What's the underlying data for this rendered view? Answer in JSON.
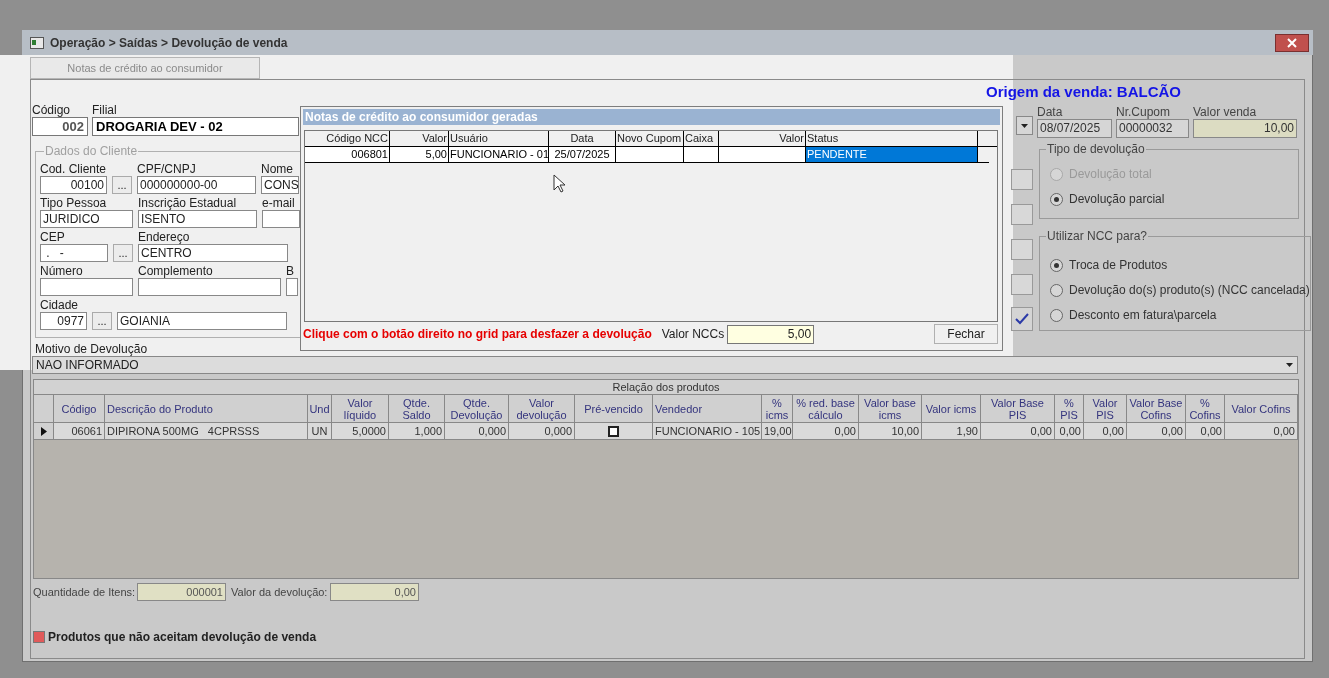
{
  "window": {
    "title": "Operação > Saídas > Devolução de venda"
  },
  "top_button": "Notas de crédito ao consumidor",
  "origin": "Origem da venda: BALCÃO",
  "header": [
    {
      "label": "Código",
      "value": "002"
    },
    {
      "label": "Filial",
      "value": "DROGARIA DEV - 02"
    }
  ],
  "cliente": {
    "title": "Dados do Cliente",
    "rows": [
      [
        {
          "label": "Cod. Cliente",
          "value": "00100",
          "lookup": "..."
        },
        {
          "label": "CPF/CNPJ",
          "value": "000000000-00"
        },
        {
          "label": "Nome",
          "value": "CONS"
        }
      ],
      [
        {
          "label": "Tipo Pessoa",
          "value": "JURIDICO"
        },
        {
          "label": "Inscrição Estadual",
          "value": "ISENTO"
        },
        {
          "label": "e-mail"
        }
      ],
      [
        {
          "label": "CEP",
          "value": " .   -",
          "lookup": "..."
        },
        {
          "label": "Endereço",
          "value": "CENTRO"
        }
      ],
      [
        {
          "label": "Número"
        },
        {
          "label": "Complemento"
        },
        {
          "label": "B"
        }
      ],
      [
        {
          "label": "Cidade",
          "value": "0977",
          "lookup": "..."
        },
        {
          "value": "GOIANIA"
        }
      ]
    ]
  },
  "dialog": {
    "title": "Notas de crédito ao consumidor geradas",
    "columns": [
      "Código NCC",
      "Valor",
      "Usuário",
      "Data",
      "Novo Cupom",
      "Caixa",
      "Valor",
      "Status"
    ],
    "rows": [
      {
        "cells": [
          {
            "text": "006801",
            "selected": false
          },
          {
            "text": "5,00",
            "selected": false
          },
          {
            "text": "FUNCIONARIO - 01",
            "selected": false
          },
          {
            "text": "25/07/2025",
            "selected": false
          },
          {
            "selected": false
          },
          {
            "selected": false
          },
          {
            "selected": false
          },
          {
            "text": "PENDENTE",
            "selected": true
          }
        ]
      }
    ],
    "hint": "Clique com o botão direito no grid para desfazer a devolução",
    "total_label": "Valor NCCs",
    "total_value": "5,00",
    "close_button": "Fechar"
  },
  "sale": [
    {
      "label": "Data",
      "value": "08/07/2025"
    },
    {
      "label": "Nr.Cupom",
      "value": "00000032"
    },
    {
      "label": "Valor venda",
      "value": "10,00"
    }
  ],
  "tipo_devolucao": {
    "title": "Tipo de devolução",
    "options": [
      {
        "label": "Devolução total",
        "selected": false,
        "disabled": true
      },
      {
        "label": "Devolução parcial",
        "selected": true,
        "disabled": false
      }
    ]
  },
  "utilizar_ncc": {
    "title": "Utilizar NCC para?",
    "options": [
      {
        "label": "Troca de Produtos",
        "selected": true,
        "disabled": false
      },
      {
        "label": "Devolução do(s) produto(s) (NCC cancelada)",
        "selected": false,
        "disabled": false
      },
      {
        "label": "Desconto em fatura\\parcela",
        "selected": false,
        "disabled": false
      }
    ]
  },
  "motivo": {
    "label": "Motivo de Devolução",
    "value": "NAO INFORMADO"
  },
  "products": {
    "title": "Relação dos produtos",
    "columns": [
      "Código",
      "Descrição do Produto",
      "Und",
      "Valor\nlíquido",
      "Qtde.\nSaldo",
      "Qtde.\nDevolução",
      "Valor\ndevolução",
      "Pré-vencido",
      "Vendedor",
      "%\nicms",
      "% red. base\ncálculo",
      "Valor base\nicms",
      "Valor icms",
      "Valor Base\nPIS",
      "%\nPIS",
      "Valor\nPIS",
      "Valor Base\nCofins",
      "%\nCofins",
      "Valor Cofins"
    ],
    "rows": [
      {
        "current": true,
        "cells": [
          {
            "kind": "text",
            "text": "06061"
          },
          {
            "kind": "text",
            "text": "DIPIRONA 500MG   4CPRSSS"
          },
          {
            "kind": "text",
            "text": "UN"
          },
          {
            "kind": "text",
            "text": "5,0000"
          },
          {
            "kind": "text",
            "text": "1,000"
          },
          {
            "kind": "text",
            "text": "0,000"
          },
          {
            "kind": "text",
            "text": "0,000"
          },
          {
            "kind": "checkbox",
            "checked": false
          },
          {
            "kind": "text",
            "text": "FUNCIONARIO - 105"
          },
          {
            "kind": "text",
            "text": "19,00"
          },
          {
            "kind": "text",
            "text": "0,00"
          },
          {
            "kind": "text",
            "text": "10,00"
          },
          {
            "kind": "text",
            "text": "1,90"
          },
          {
            "kind": "text",
            "text": "0,00"
          },
          {
            "kind": "text",
            "text": "0,00"
          },
          {
            "kind": "text",
            "text": "0,00"
          },
          {
            "kind": "text",
            "text": "0,00"
          },
          {
            "kind": "text",
            "text": "0,00"
          },
          {
            "kind": "text",
            "text": "0,00"
          }
        ]
      }
    ]
  },
  "totals": [
    {
      "label": "Quantidade de Itens:",
      "value": "000001"
    },
    {
      "label": "Valor da devolução:",
      "value": "0,00"
    }
  ],
  "legend": {
    "color": "#e05a5a",
    "label": "Produtos que não aceitam devolução de venda"
  }
}
